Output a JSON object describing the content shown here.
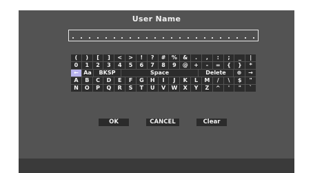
{
  "dialog": {
    "title": "User Name"
  },
  "name_field": {
    "value": "",
    "slots": 23
  },
  "keyboard": {
    "row1": [
      "(",
      ")",
      "[",
      "]",
      "<",
      ">",
      "!",
      "?",
      "#",
      "%",
      "&",
      ".",
      ",",
      ":",
      ";",
      "_",
      "|"
    ],
    "row2": [
      "0",
      "1",
      "2",
      "3",
      "4",
      "5",
      "6",
      "7",
      "8",
      "9",
      "@",
      "+",
      "-",
      "=",
      "{",
      "}",
      "*"
    ],
    "row3": {
      "left_arrow": "←",
      "case_label": "Aa",
      "bksp_label": "BKSP",
      "space_label": "Space",
      "delete_label": "Delete",
      "globe": "⊕",
      "right_arrow": "→"
    },
    "row4": [
      "A",
      "B",
      "C",
      "D",
      "E",
      "F",
      "G",
      "H",
      "I",
      "J",
      "K",
      "L",
      "M",
      "/",
      "\\",
      "$",
      "\""
    ],
    "row5": [
      "N",
      "O",
      "P",
      "Q",
      "R",
      "S",
      "T",
      "U",
      "V",
      "W",
      "X",
      "Y",
      "Z",
      "^",
      "'",
      "\"",
      "`"
    ]
  },
  "buttons": {
    "ok": "OK",
    "cancel": "CANCEL",
    "clear": "Clear"
  },
  "colors": {
    "background": "#535353",
    "key": "#2c2c2c",
    "selected_key": "#b9b4ee",
    "text": "#f4f4f4"
  }
}
